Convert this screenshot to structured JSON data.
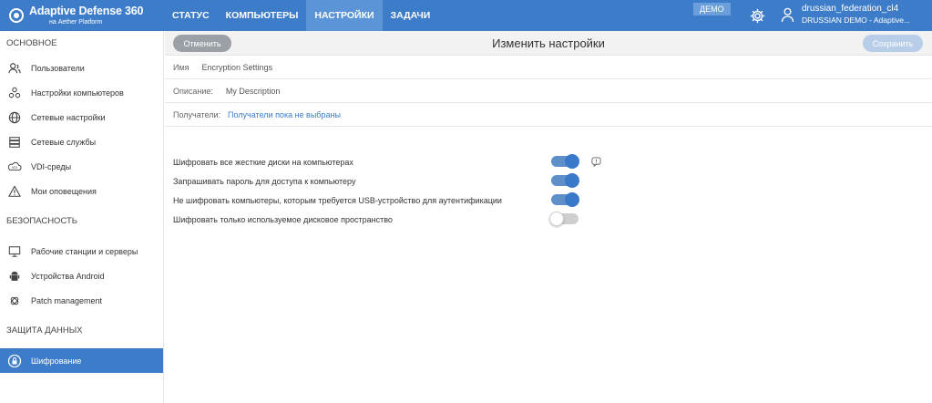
{
  "brand": {
    "name": "Adaptive Defense 360",
    "sub": "на Aether Platform"
  },
  "nav": [
    {
      "label": "СТАТУС"
    },
    {
      "label": "КОМПЬЮТЕРЫ"
    },
    {
      "label": "НАСТРОЙКИ"
    },
    {
      "label": "ЗАДАЧИ"
    }
  ],
  "demo_badge": "ДЕМО",
  "user": {
    "name": "drussian_federation_cl4",
    "org": "DRUSSIAN DEMO - Adaptive..."
  },
  "sidebar": {
    "sections": [
      {
        "title": "ОСНОВНОЕ",
        "items": [
          {
            "label": "Пользователи",
            "icon": "users-icon"
          },
          {
            "label": "Настройки компьютеров",
            "icon": "computer-settings-icon"
          },
          {
            "label": "Сетевые настройки",
            "icon": "globe-icon"
          },
          {
            "label": "Сетевые службы",
            "icon": "server-icon"
          },
          {
            "label": "VDI-среды",
            "icon": "vdi-icon"
          },
          {
            "label": "Мои оповещения",
            "icon": "warning-icon"
          }
        ]
      },
      {
        "title": "БЕЗОПАСНОСТЬ",
        "items": [
          {
            "label": "Рабочие станции и серверы",
            "icon": "monitor-icon"
          },
          {
            "label": "Устройства Android",
            "icon": "android-icon"
          },
          {
            "label": "Patch management",
            "icon": "patch-icon"
          }
        ]
      },
      {
        "title": "ЗАЩИТА ДАННЫХ",
        "items": [
          {
            "label": "Шифрование",
            "icon": "encryption-icon"
          }
        ]
      }
    ]
  },
  "header": {
    "cancel": "Отменить",
    "title": "Изменить настройки",
    "save": "Сохранить"
  },
  "fields": {
    "name": {
      "label": "Имя",
      "value": "Encryption Settings"
    },
    "description": {
      "label": "Описание:",
      "value": "My Description"
    },
    "recipients": {
      "label": "Получатели:",
      "value": "Получатели пока не выбраны"
    }
  },
  "options": [
    {
      "label": "Шифровать все жесткие диски на компьютерах",
      "enabled": true
    },
    {
      "label": "Запрашивать пароль для доступа к компьютеру",
      "enabled": true
    },
    {
      "label": "Не шифровать компьютеры, которым требуется USB-устройство для аутентификации",
      "enabled": true
    },
    {
      "label": "Шифровать только используемое дисковое пространство",
      "enabled": false
    }
  ],
  "colors": {
    "accent": "#3d7cc9",
    "toggle_on": "#3a78c9",
    "toggle_off": "#cfcfcf"
  }
}
